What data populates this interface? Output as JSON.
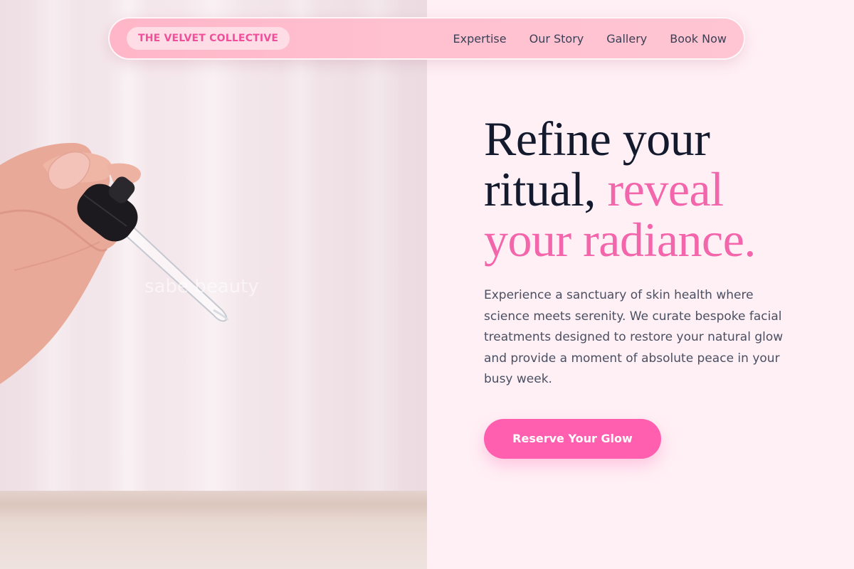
{
  "nav": {
    "brand": "THE VELVET COLLECTIVE",
    "items": [
      {
        "label": "Expertise"
      },
      {
        "label": "Our Story"
      },
      {
        "label": "Gallery"
      },
      {
        "label": "Book Now"
      }
    ]
  },
  "hero": {
    "headline_part1": "Refine your ritual, ",
    "headline_accent": "reveal your radiance.",
    "lead": "Experience a sanctuary of skin health where science meets serenity. We curate bespoke facial treatments designed to restore your natural glow and provide a moment of absolute peace in your busy week.",
    "cta_label": "Reserve Your Glow"
  },
  "image": {
    "watermark": "sabe beauty",
    "subject": "hand holding serum dropper"
  },
  "colors": {
    "accent": "#ff5fae",
    "headline_accent": "#f466ac",
    "headline": "#141a2e",
    "nav_bg": "#ffc0cf",
    "page_bg": "#fff0f5"
  }
}
